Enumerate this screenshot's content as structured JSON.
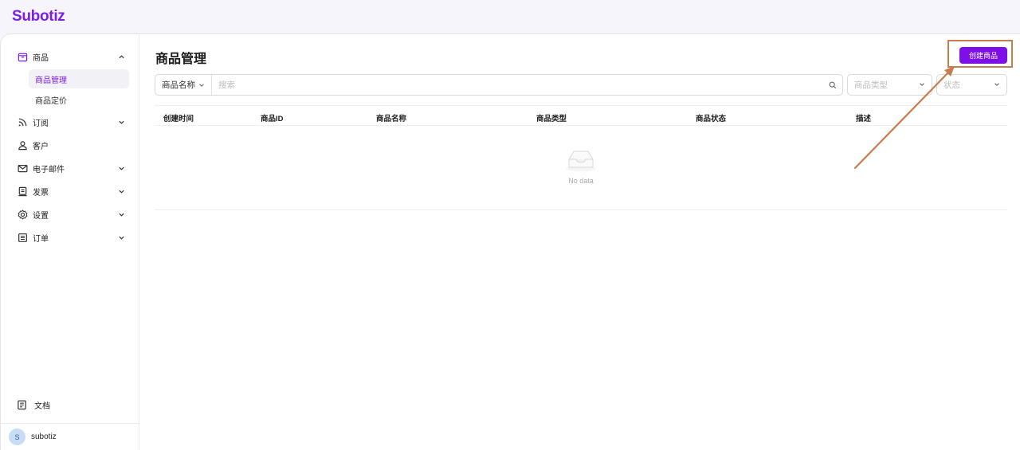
{
  "app": {
    "logo": "Subotiz"
  },
  "sidebar": {
    "products": {
      "label": "商品",
      "sub": [
        {
          "label": "商品管理"
        },
        {
          "label": "商品定价"
        }
      ]
    },
    "subscriptions": {
      "label": "订阅"
    },
    "customers": {
      "label": "客户"
    },
    "email": {
      "label": "电子邮件"
    },
    "invoices": {
      "label": "发票"
    },
    "settings": {
      "label": "设置"
    },
    "orders": {
      "label": "订单"
    },
    "docs": {
      "label": "文档"
    },
    "user": {
      "avatar": "S",
      "name": "subotiz"
    }
  },
  "main": {
    "title": "商品管理",
    "create_button": "创建商品",
    "search": {
      "field": "商品名称",
      "placeholder": "搜索"
    },
    "filters": {
      "type_placeholder": "商品类型",
      "status_placeholder": "状态"
    },
    "table": {
      "columns": [
        "创建时间",
        "商品ID",
        "商品名称",
        "商品类型",
        "商品状态",
        "描述"
      ],
      "empty_text": "No data"
    }
  },
  "colors": {
    "brand": "#7c1de8",
    "button": "#7c10e6",
    "annotation": "#c77d4e"
  },
  "icons": [
    "box-icon",
    "chevron-up-icon",
    "rss-icon",
    "user-icon",
    "mail-icon",
    "invoice-icon",
    "gear-icon",
    "list-icon",
    "doc-icon",
    "search-icon",
    "chevron-down-icon",
    "empty-inbox-icon"
  ]
}
